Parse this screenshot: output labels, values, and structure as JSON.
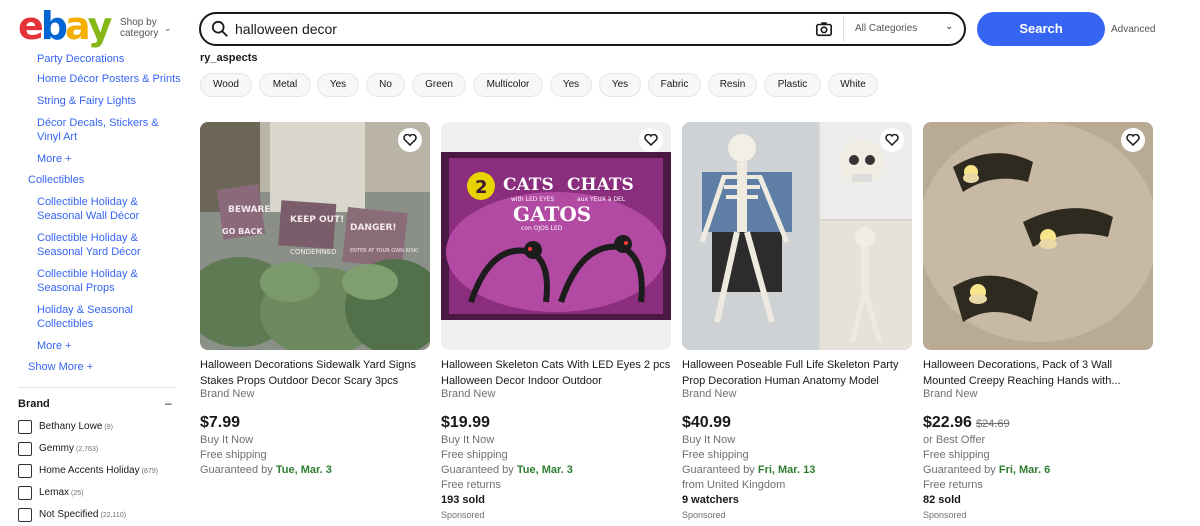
{
  "header": {
    "logo_letters": [
      "e",
      "b",
      "a",
      "y"
    ],
    "logo_colors": [
      "#e53238",
      "#0064d2",
      "#f5af02",
      "#86b817"
    ],
    "shop_by_line1": "Shop by",
    "shop_by_line2": "category",
    "search_value": "halloween decor",
    "category_select": "All Categories",
    "search_button": "Search",
    "advanced_link": "Advanced"
  },
  "sidebar": {
    "sub_links_top": [
      "Party Decorations",
      "Home Décor Posters & Prints",
      "String & Fairy Lights",
      "Décor Decals, Stickers & Vinyl Art"
    ],
    "more_1": "More",
    "collectibles": "Collectibles",
    "sub_links_collectibles": [
      "Collectible Holiday & Seasonal Wall Décor",
      "Collectible Holiday & Seasonal Yard Décor",
      "Collectible Holiday & Seasonal Props",
      "Holiday & Seasonal Collectibles"
    ],
    "more_2": "More",
    "show_more": "Show More",
    "brand_heading": "Brand",
    "brands": [
      {
        "label": "Bethany Lowe",
        "count": "(9)"
      },
      {
        "label": "Gemmy",
        "count": "(2,763)"
      },
      {
        "label": "Home Accents Holiday",
        "count": "(879)"
      },
      {
        "label": "Lemax",
        "count": "(25)"
      },
      {
        "label": "Not Specified",
        "count": "(22,110)"
      }
    ]
  },
  "aspects": {
    "heading": "ry_aspects",
    "chips": [
      "Wood",
      "Metal",
      "Yes",
      "No",
      "Green",
      "Multicolor",
      "Yes",
      "Yes",
      "Fabric",
      "Resin",
      "Plastic",
      "White"
    ]
  },
  "products": [
    {
      "title": "Halloween Decorations Sidewalk Yard Signs Stakes Props Outdoor Decor Scary 3pcs",
      "condition": "Brand New",
      "price": "$7.99",
      "old_price": "",
      "buy": "Buy It Now",
      "shipping": "Free shipping",
      "guaranteed": "Guaranteed by",
      "date": "Tue, Mar. 3",
      "extra1": "",
      "extra2": "",
      "sponsored": "",
      "sign_texts": [
        "BEWARE",
        "GO BACK",
        "KEEP OUT!",
        "DANGER!",
        "ENTER AT YOUR OWN RISK!",
        "CONDEMNED"
      ]
    },
    {
      "title": "Halloween Skeleton Cats With LED Eyes 2 pcs Halloween Decor Indoor Outdoor",
      "condition": "Brand New",
      "price": "$19.99",
      "old_price": "",
      "buy": "Buy It Now",
      "shipping": "Free shipping",
      "guaranteed": "Guaranteed by",
      "date": "Tue, Mar. 3",
      "extra1": "Free returns",
      "extra2": "193 sold",
      "sponsored": "Sponsored",
      "box_num": "2",
      "box_cats": "CATS",
      "box_chats": "CHATS",
      "box_led": "with LED EYES",
      "box_yeux": "aux YEUX à DEL",
      "box_gatos": "GATOS",
      "box_ojos": "con OJOS LED"
    },
    {
      "title": "Halloween Poseable Full Life Skeleton Party Prop Decoration Human Anatomy Model",
      "condition": "Brand New",
      "price": "$40.99",
      "old_price": "",
      "buy": "Buy It Now",
      "shipping": "Free shipping",
      "guaranteed": "Guaranteed by",
      "date": "Fri, Mar. 13",
      "extra1": "from United Kingdom",
      "extra2": "9 watchers",
      "sponsored": "Sponsored"
    },
    {
      "title": "Halloween Decorations, Pack of 3 Wall Mounted Creepy Reaching Hands with...",
      "condition": "Brand New",
      "price": "$22.96",
      "old_price": "$24.69",
      "buy": "or Best Offer",
      "shipping": "Free shipping",
      "guaranteed": "Guaranteed by",
      "date": "Fri, Mar. 6",
      "extra1": "Free returns",
      "extra2": "82 sold",
      "sponsored": "Sponsored"
    }
  ],
  "colors": {
    "link": "#3665f3",
    "search_button": "#3665f3",
    "date_green": "#2e7d32"
  }
}
